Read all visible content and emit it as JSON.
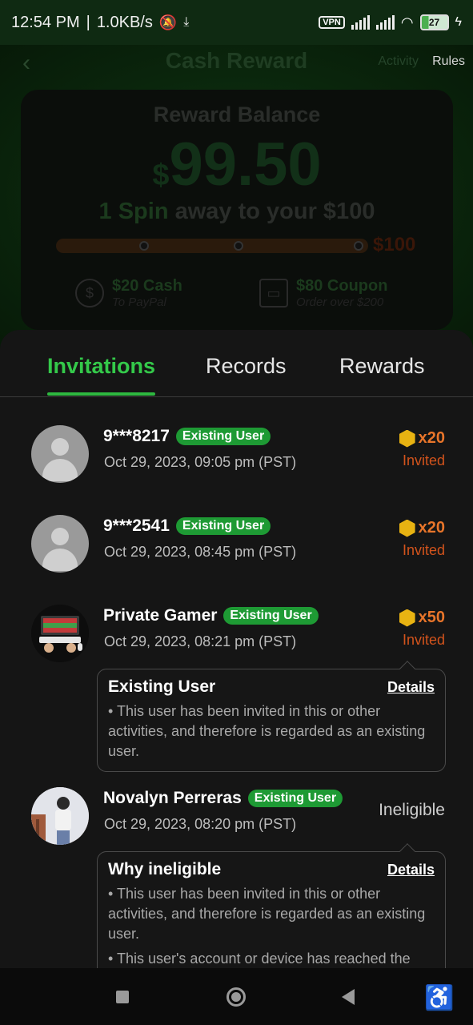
{
  "status_bar": {
    "time": "12:54 PM",
    "speed": "1.0KB/s",
    "vpn": "VPN",
    "battery": "27"
  },
  "header": {
    "title": "Cash Reward",
    "activity": "Activity",
    "rules": "Rules"
  },
  "balance": {
    "label": "Reward Balance",
    "currency": "$",
    "amount": "99.50",
    "spin_highlight": "1 Spin",
    "spin_rest": " away to your $100",
    "goal": "$100",
    "progress": 0.995,
    "perk1_title": "$20 Cash",
    "perk1_sub": "To PayPal",
    "perk2_title": "$80 Coupon",
    "perk2_sub": "Order over $200"
  },
  "tabs": [
    {
      "label": "Invitations"
    },
    {
      "label": "Records"
    },
    {
      "label": "Rewards"
    }
  ],
  "invitations": [
    {
      "name": "9***8217",
      "badge": "Existing User",
      "date": "Oct 29, 2023, 09:05 pm (PST)",
      "count": "x20",
      "status": "Invited"
    },
    {
      "name": "9***2541",
      "badge": "Existing User",
      "date": "Oct 29, 2023, 08:45 pm (PST)",
      "count": "x20",
      "status": "Invited"
    },
    {
      "name": "Private Gamer",
      "badge": "Existing User",
      "date": "Oct 29, 2023, 08:21 pm (PST)",
      "count": "x50",
      "status": "Invited",
      "tip": {
        "title": "Existing User",
        "link": "Details",
        "lines": [
          "• This user has been invited in this or other activities, and therefore is regarded as an existing user."
        ]
      }
    },
    {
      "name": "Novalyn Perreras",
      "badge": "Existing User",
      "date": "Oct 29, 2023, 08:20 pm (PST)",
      "status": "Ineligible",
      "tip": {
        "title": "Why ineligible",
        "link": "Details",
        "lines": [
          "• This user has been invited in this or other activities, and therefore is regarded as an existing user.",
          "• This user's account or device has reached the"
        ]
      }
    }
  ],
  "colors": {
    "accent_green": "#34c94a",
    "badge_green": "#1e9a34",
    "reward_orange": "#e8752a",
    "coin_gold": "#e8b312"
  },
  "icons": [
    "back-arrow-icon",
    "dollar-icon",
    "ticket-icon",
    "coin-icon",
    "user-placeholder-icon",
    "accessibility-icon"
  ]
}
